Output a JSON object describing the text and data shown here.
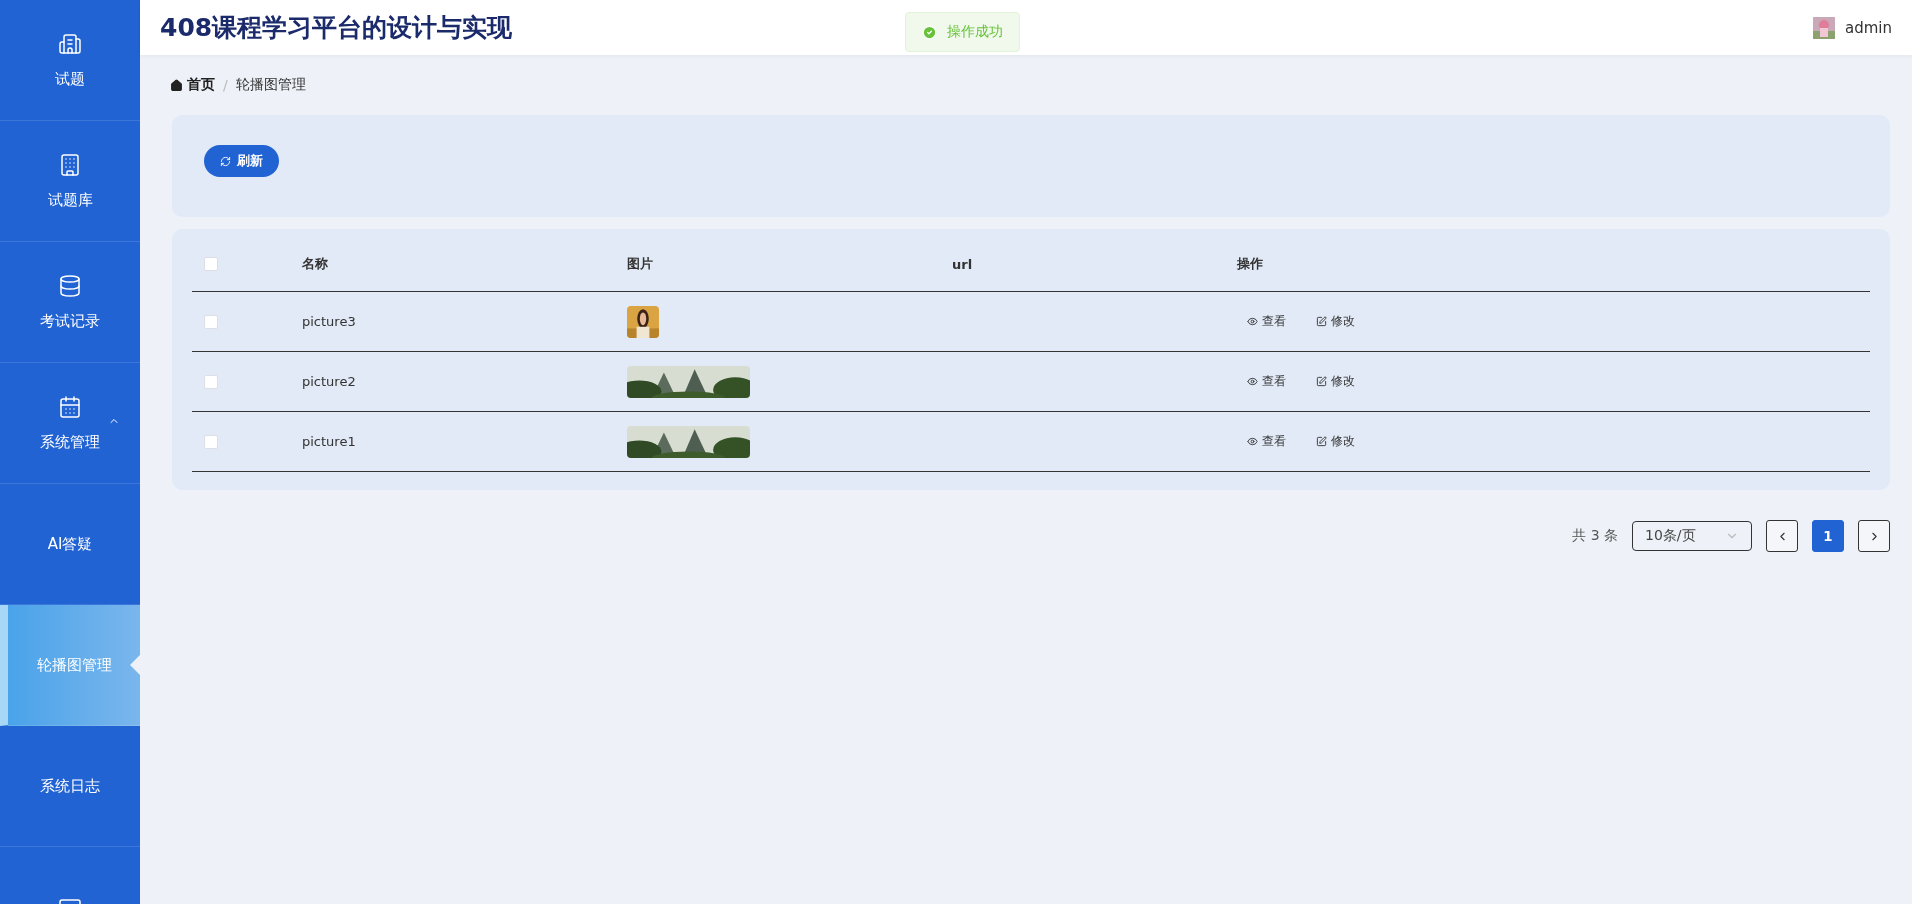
{
  "sidebar": {
    "items": [
      {
        "kind": "icon",
        "label": "试题",
        "selected": false
      },
      {
        "kind": "icon",
        "label": "试题库",
        "selected": false
      },
      {
        "kind": "icon",
        "label": "考试记录",
        "selected": false
      },
      {
        "kind": "icon",
        "label": "系统管理",
        "selected": false,
        "expanded": true
      },
      {
        "kind": "text",
        "label": "AI答疑",
        "selected": false
      },
      {
        "kind": "text",
        "label": "轮播图管理",
        "selected": true
      },
      {
        "kind": "text",
        "label": "系统日志",
        "selected": false
      },
      {
        "kind": "icon",
        "selected": false
      }
    ]
  },
  "header": {
    "title": "408课程学习平台的设计与实现",
    "user": "admin"
  },
  "toast": {
    "text": "操作成功"
  },
  "breadcrumb_separator": "/",
  "breadcrumb": [
    {
      "label": "首页",
      "kind": "home"
    },
    {
      "label": "轮播图管理",
      "kind": "current"
    }
  ],
  "toolbar": {
    "refresh_button": "刷新"
  },
  "table": {
    "select_all": {
      "checked": false
    },
    "columns": [
      "名称",
      "图片",
      "url",
      "操作"
    ],
    "rows": [
      {
        "checked": false,
        "name": "picture3",
        "image": {
          "kind": "portrait"
        },
        "actions": [
          "查看",
          "修改"
        ]
      },
      {
        "checked": false,
        "name": "picture2",
        "image": {
          "kind": "landscape"
        },
        "actions": [
          "查看",
          "修改"
        ]
      },
      {
        "checked": false,
        "name": "picture1",
        "image": {
          "kind": "landscape"
        },
        "actions": [
          "查看",
          "修改"
        ]
      }
    ]
  },
  "pagination": {
    "total": "共 3 条",
    "page_size": "10条/页",
    "pages": [
      {
        "label": "1",
        "selected": true
      }
    ]
  }
}
